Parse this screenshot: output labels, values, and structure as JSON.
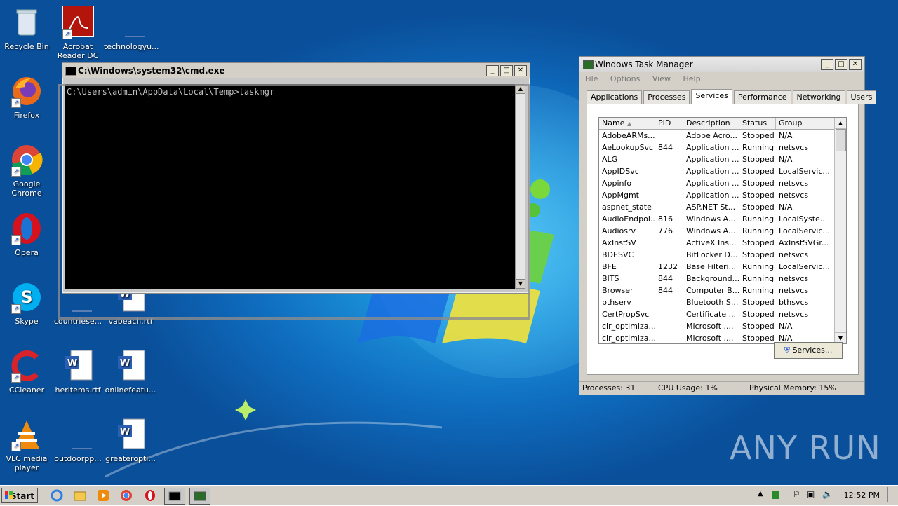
{
  "desktop_icons": [
    {
      "name": "recycle-bin",
      "label": "Recycle Bin"
    },
    {
      "name": "acrobat-reader",
      "label": "Acrobat Reader DC"
    },
    {
      "name": "technologyu-file",
      "label": "technologyu..."
    },
    {
      "name": "firefox",
      "label": "Firefox"
    },
    {
      "name": "google-chrome",
      "label": "Google Chrome"
    },
    {
      "name": "opera",
      "label": "Opera"
    },
    {
      "name": "skype",
      "label": "Skype"
    },
    {
      "name": "countriese-file",
      "label": "countriese..."
    },
    {
      "name": "vabeach-file",
      "label": "vabeach.rtf"
    },
    {
      "name": "ccleaner",
      "label": "CCleaner"
    },
    {
      "name": "heritems-file",
      "label": "heritems.rtf"
    },
    {
      "name": "onlinefeatu-file",
      "label": "onlinefeatu..."
    },
    {
      "name": "vlc-player",
      "label": "VLC media player"
    },
    {
      "name": "outdoorpp-file",
      "label": "outdoorpp..."
    },
    {
      "name": "greateropti-file",
      "label": "greateropti..."
    }
  ],
  "cmd": {
    "title": "C:\\Windows\\system32\\cmd.exe",
    "line": "C:\\Users\\admin\\AppData\\Local\\Temp>taskmgr"
  },
  "taskmanager": {
    "title": "Windows Task Manager",
    "menu": [
      "File",
      "Options",
      "View",
      "Help"
    ],
    "tabs": [
      "Applications",
      "Processes",
      "Services",
      "Performance",
      "Networking",
      "Users"
    ],
    "active_tab": "Services",
    "columns": [
      "Name",
      "PID",
      "Description",
      "Status",
      "Group"
    ],
    "rows": [
      [
        "AdobeARMs...",
        "",
        "Adobe Acro...",
        "Stopped",
        "N/A"
      ],
      [
        "AeLookupSvc",
        "844",
        "Application ...",
        "Running",
        "netsvcs"
      ],
      [
        "ALG",
        "",
        "Application ...",
        "Stopped",
        "N/A"
      ],
      [
        "AppIDSvc",
        "",
        "Application ...",
        "Stopped",
        "LocalServic..."
      ],
      [
        "Appinfo",
        "",
        "Application ...",
        "Stopped",
        "netsvcs"
      ],
      [
        "AppMgmt",
        "",
        "Application ...",
        "Stopped",
        "netsvcs"
      ],
      [
        "aspnet_state",
        "",
        "ASP.NET St...",
        "Stopped",
        "N/A"
      ],
      [
        "AudioEndpoi...",
        "816",
        "Windows A...",
        "Running",
        "LocalSyste..."
      ],
      [
        "Audiosrv",
        "776",
        "Windows A...",
        "Running",
        "LocalServic..."
      ],
      [
        "AxInstSV",
        "",
        "ActiveX Ins...",
        "Stopped",
        "AxInstSVGr..."
      ],
      [
        "BDESVC",
        "",
        "BitLocker D...",
        "Stopped",
        "netsvcs"
      ],
      [
        "BFE",
        "1232",
        "Base Filteri...",
        "Running",
        "LocalServic..."
      ],
      [
        "BITS",
        "844",
        "Background...",
        "Running",
        "netsvcs"
      ],
      [
        "Browser",
        "844",
        "Computer B...",
        "Running",
        "netsvcs"
      ],
      [
        "bthserv",
        "",
        "Bluetooth S...",
        "Stopped",
        "bthsvcs"
      ],
      [
        "CertPropSvc",
        "",
        "Certificate ...",
        "Stopped",
        "netsvcs"
      ],
      [
        "clr_optimiza...",
        "",
        "Microsoft ....",
        "Stopped",
        "N/A"
      ],
      [
        "clr_optimiza...",
        "",
        "Microsoft ....",
        "Stopped",
        "N/A"
      ]
    ],
    "services_button": "Services...",
    "status": {
      "processes": "Processes: 31",
      "cpu": "CPU Usage: 1%",
      "memory": "Physical Memory: 15%"
    }
  },
  "taskbar": {
    "start_label": "Start",
    "clock": "12:52 PM"
  },
  "watermark": "ANY RUN"
}
